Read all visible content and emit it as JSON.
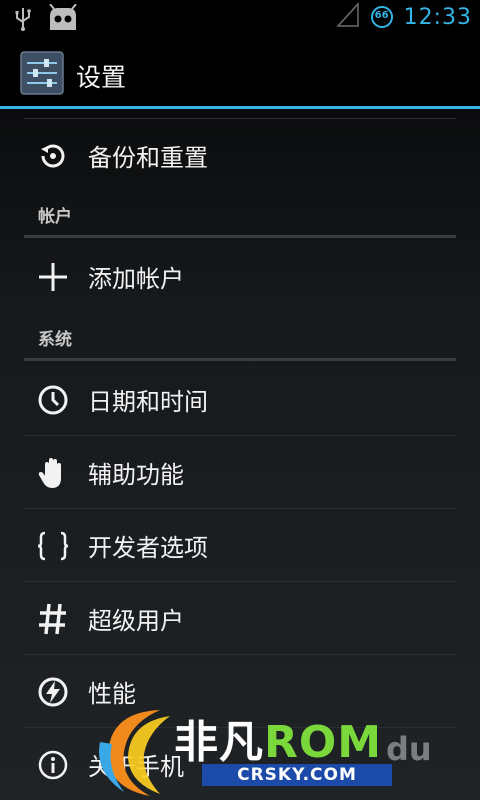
{
  "status_bar": {
    "time": "12:33",
    "notification_badge": "66",
    "icons": [
      "usb-icon",
      "android-icon",
      "signal-icon",
      "badge-icon"
    ]
  },
  "action_bar": {
    "title": "设置",
    "icon": "settings-sliders-icon"
  },
  "items_top": [
    {
      "label": "备份和重置",
      "icon": "backup-restore-icon"
    }
  ],
  "sections": [
    {
      "title": "帐户",
      "items": [
        {
          "label": "添加帐户",
          "icon": "plus-icon"
        }
      ]
    },
    {
      "title": "系统",
      "items": [
        {
          "label": "日期和时间",
          "icon": "clock-icon"
        },
        {
          "label": "辅助功能",
          "icon": "hand-icon"
        },
        {
          "label": "开发者选项",
          "icon": "braces-icon"
        },
        {
          "label": "超级用户",
          "icon": "hash-icon"
        },
        {
          "label": "性能",
          "icon": "lightning-icon"
        },
        {
          "label": "关于手机",
          "icon": "info-icon"
        }
      ]
    }
  ],
  "watermark": {
    "brand_main": "非凡",
    "brand_rom": "ROM",
    "brand_du": "du",
    "site": "CRSKY.COM"
  },
  "colors": {
    "accent": "#33b5e5",
    "background": "#16191c",
    "text": "#f2f2f2"
  }
}
